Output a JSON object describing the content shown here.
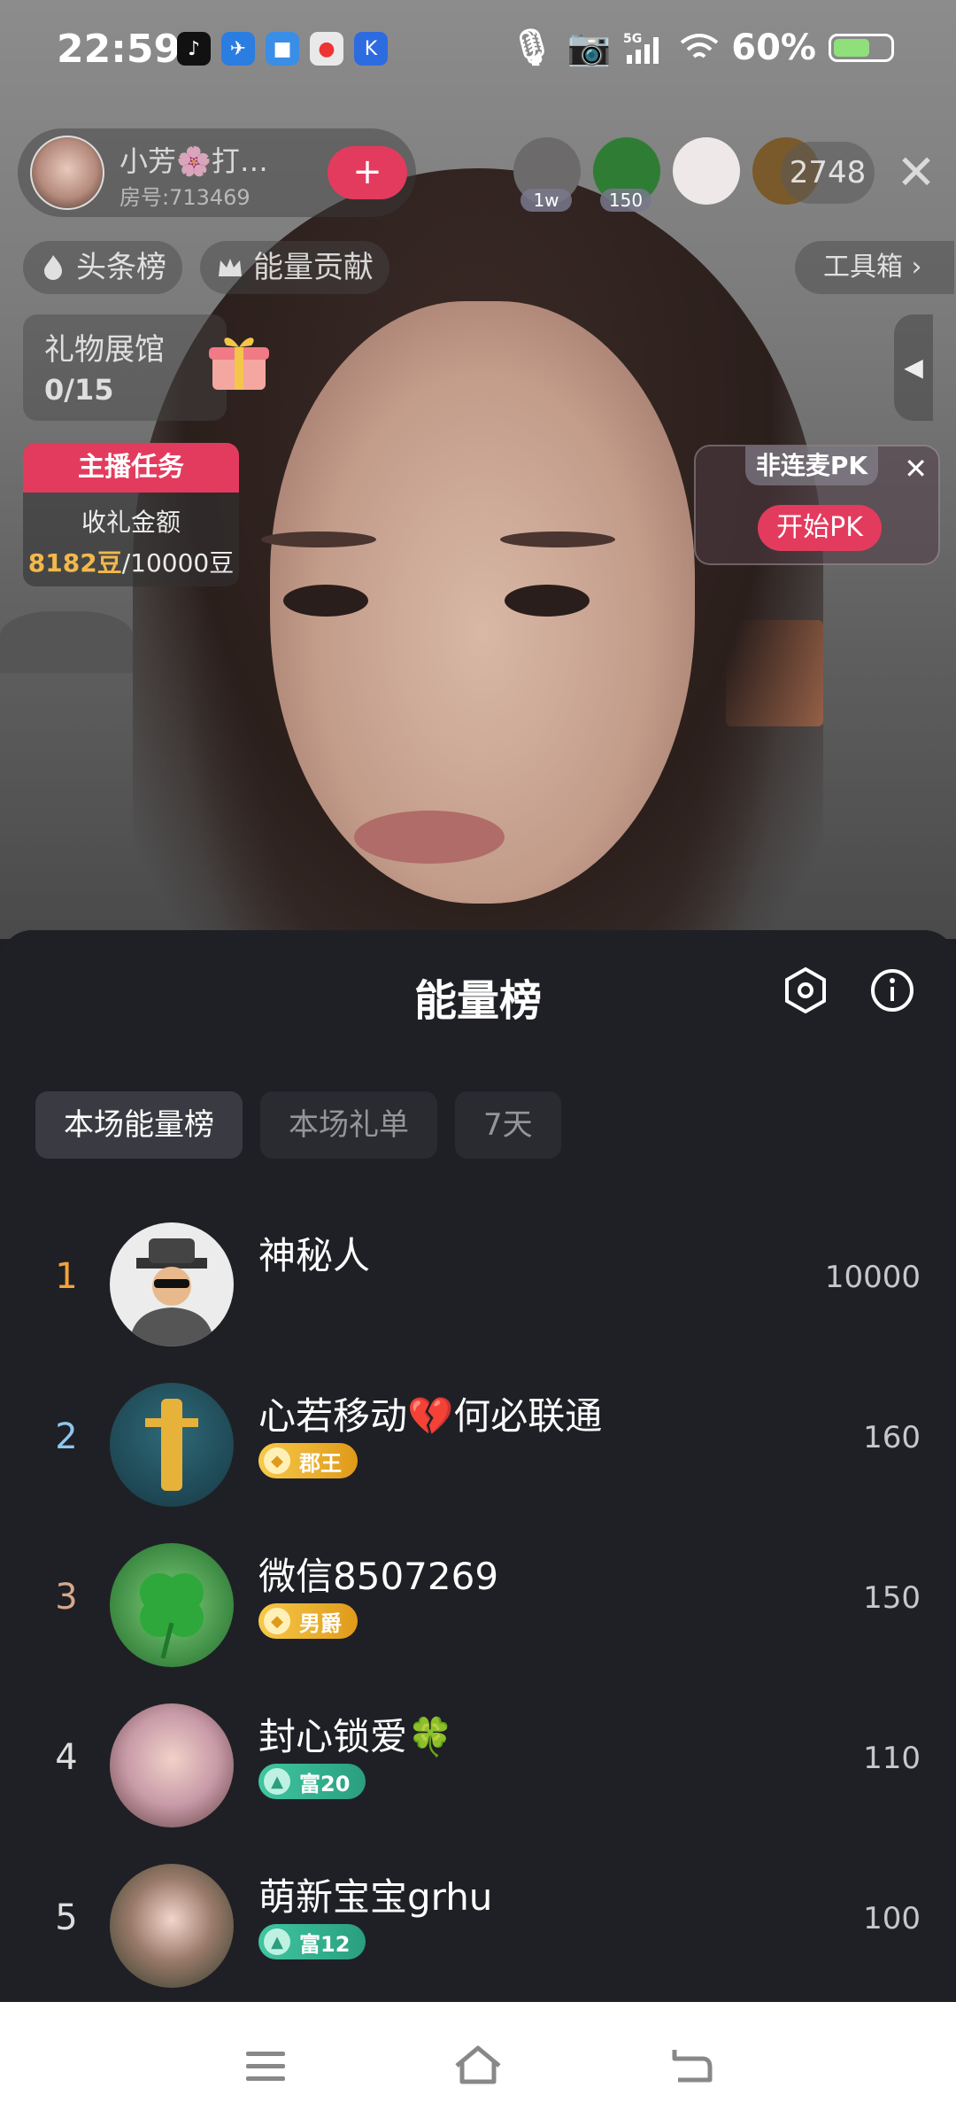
{
  "status_bar": {
    "time": "22:59",
    "battery": "60%",
    "app_icons": [
      "tiktok-icon",
      "app-icon",
      "app-icon",
      "app-icon",
      "app-icon"
    ],
    "battery_level": 0.6
  },
  "live": {
    "host_name": "小芳🌸打…",
    "room_id": "房号:713469",
    "follow_label": "+",
    "viewers": [
      {
        "badge": "1w",
        "color": "#6c6a6a"
      },
      {
        "badge": "150",
        "color": "#2f7d34"
      },
      {
        "badge": "",
        "color": "#efe8e8"
      },
      {
        "badge": "",
        "color": "#7a5a2a"
      }
    ],
    "viewer_count": "2748",
    "headline_label": "头条榜",
    "energy_contrib_label": "能量贡献",
    "toolbox_label": "工具箱 ›",
    "gift_hall_title": "礼物展馆",
    "gift_hall_count": "0/15",
    "task_title": "主播任务",
    "task_line1": "收礼金额",
    "task_progress_gold": "8182豆",
    "task_progress_rest": "/10000豆",
    "pk_tag": "非连麦PK",
    "pk_button": "开始PK"
  },
  "sheet": {
    "title": "能量榜",
    "tabs": [
      "本场能量榜",
      "本场礼单",
      "7天"
    ],
    "active_tab": 0,
    "entries": [
      {
        "rank": "1",
        "name": "神秘人",
        "badge": "",
        "badge_type": "",
        "score": "10000",
        "rank_color": "#f2a33a",
        "avatar_color": "#ececec"
      },
      {
        "rank": "2",
        "name": "心若移动💔何必联通",
        "badge": "郡王",
        "badge_type": "gold",
        "score": "160",
        "rank_color": "#8fc6ee",
        "avatar_color": "#1e4a5a"
      },
      {
        "rank": "3",
        "name": "微信8507269",
        "badge": "男爵",
        "badge_type": "gold",
        "score": "150",
        "rank_color": "#d9a78a",
        "avatar_color": "#2e8a3a"
      },
      {
        "rank": "4",
        "name": "封心锁爱🍀",
        "badge": "富20",
        "badge_type": "green",
        "score": "110",
        "rank_color": "#dddddd",
        "avatar_color": "#c9a4b0"
      },
      {
        "rank": "5",
        "name": "萌新宝宝grhu",
        "badge": "富12",
        "badge_type": "green",
        "score": "100",
        "rank_color": "#dddddd",
        "avatar_color": "#3d5a3a"
      }
    ]
  }
}
